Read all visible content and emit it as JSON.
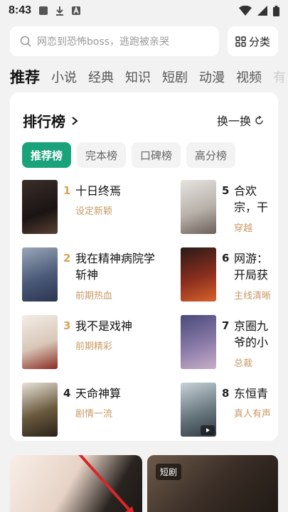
{
  "status": {
    "time": "8:43"
  },
  "search": {
    "placeholder": "网恋到恐怖boss，逃跑被亲哭"
  },
  "category": {
    "label": "分类"
  },
  "tabs": [
    "推荐",
    "小说",
    "经典",
    "知识",
    "短剧",
    "动漫",
    "视频",
    "有"
  ],
  "ranking": {
    "title": "排行榜",
    "refresh_label": "换一换",
    "filters": [
      "推荐榜",
      "完本榜",
      "口碑榜",
      "高分榜"
    ],
    "books": [
      {
        "rank": "1",
        "title": "十日终焉",
        "tag": "设定新颖"
      },
      {
        "rank": "2",
        "title": "我在精神病院学斩神",
        "tag": "前期热血"
      },
      {
        "rank": "3",
        "title": "我不是戏神",
        "tag": "前期精彩"
      },
      {
        "rank": "4",
        "title": "天命神算",
        "tag": "剧情一流"
      },
      {
        "rank": "5",
        "title": "合欢宗，干侄女乖",
        "tag": "穿越"
      },
      {
        "rank": "6",
        "title": "网游：开局获得SSS级天赋",
        "tag": "主线清晰"
      },
      {
        "rank": "7",
        "title": "京圈九爷的小玫瑰",
        "tag": "总裁"
      },
      {
        "rank": "8",
        "title": "东恒青云",
        "tag": "真人有声"
      }
    ]
  },
  "bottom": {
    "badge": "短剧"
  },
  "colors": {
    "accent": "#1aa37a",
    "tag": "#c99a66",
    "rank_top": "#d9a35a",
    "rank_other": "#222222"
  }
}
